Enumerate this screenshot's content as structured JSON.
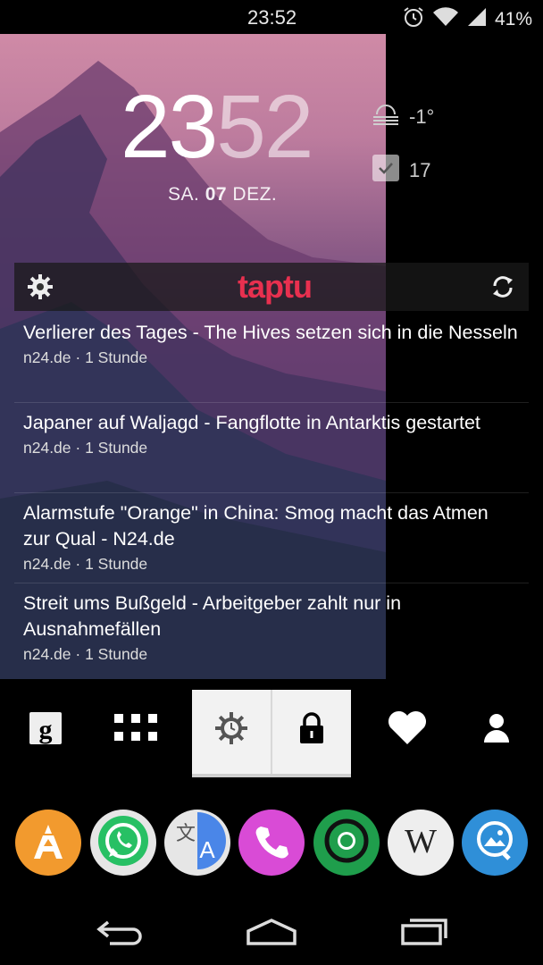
{
  "status_bar": {
    "time": "23:52",
    "battery": "41%",
    "icons": [
      "alarm-icon",
      "wifi-icon",
      "signal-icon"
    ]
  },
  "clock": {
    "hours": "23",
    "minutes": "52",
    "date_day": "SA.",
    "date_num": "07",
    "date_month": "DEZ."
  },
  "weather": {
    "icon": "fog-weather-icon",
    "temperature": "-1°"
  },
  "tasks": {
    "icon": "checkbox-icon",
    "count": "17"
  },
  "taptu": {
    "logo": "taptu",
    "items": [
      {
        "title": "Verlierer des Tages - The Hives setzen sich in die Nesseln",
        "meta": "n24.de · 1 Stunde"
      },
      {
        "title": "Japaner auf Waljagd - Fangflotte in Antarktis gestartet",
        "meta": "n24.de · 1 Stunde"
      },
      {
        "title": "Alarmstufe \"Orange\" in China: Smog macht das Atmen zur Qual - N24.de",
        "meta": "n24.de · 1 Stunde"
      },
      {
        "title": "Streit ums Bußgeld - Arbeitgeber zahlt nur in Ausnahmefällen",
        "meta": "n24.de · 1 Stunde"
      }
    ]
  },
  "toolbar": {
    "icons": [
      "google-icon",
      "app-drawer-icon",
      "brightness-icon",
      "lock-icon",
      "heart-icon",
      "contact-icon"
    ]
  },
  "dock": {
    "apps": [
      {
        "icon": "appstore-star-icon",
        "color": "#f29a2e"
      },
      {
        "icon": "whatsapp-icon",
        "color": "#27c064"
      },
      {
        "icon": "translate-icon",
        "color": "#4a86e8"
      },
      {
        "icon": "phone-icon",
        "color": "#d94bd6"
      },
      {
        "icon": "chrome-icon",
        "color": "#1f9e4c"
      },
      {
        "icon": "wikipedia-icon",
        "color": "#eeeeee"
      },
      {
        "icon": "gallery-icon",
        "color": "#2f8fd8"
      }
    ]
  },
  "navbar": {
    "buttons": [
      "back-icon",
      "home-icon",
      "recents-icon"
    ]
  }
}
